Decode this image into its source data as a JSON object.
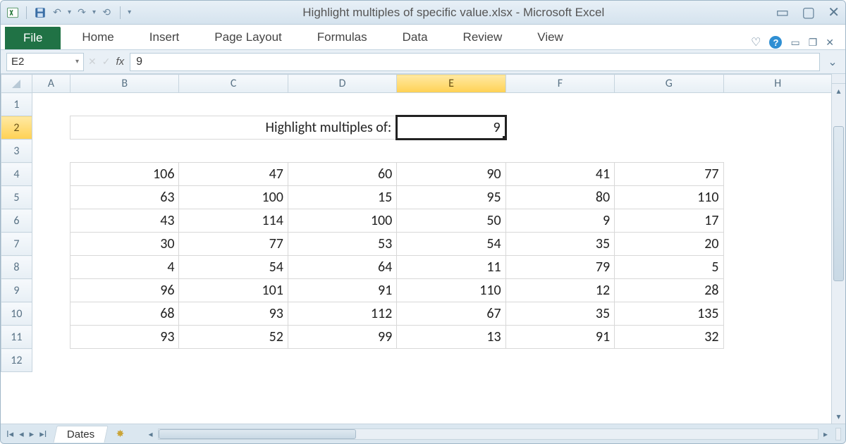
{
  "window": {
    "title": "Highlight multiples of specific value.xlsx  -  Microsoft Excel"
  },
  "ribbon": {
    "file": "File",
    "tabs": [
      "Home",
      "Insert",
      "Page Layout",
      "Formulas",
      "Data",
      "Review",
      "View"
    ]
  },
  "formula_bar": {
    "name_box": "E2",
    "fx_label": "fx",
    "value": "9"
  },
  "sheet": {
    "columns": [
      "A",
      "B",
      "C",
      "D",
      "E",
      "F",
      "G",
      "H"
    ],
    "row_headers": [
      "1",
      "2",
      "3",
      "4",
      "5",
      "6",
      "7",
      "8",
      "9",
      "10",
      "11",
      "12"
    ],
    "selected_cell": "E2",
    "label_text": "Highlight multiples of:",
    "input_value": "9",
    "data": [
      [
        106,
        47,
        60,
        90,
        41,
        77
      ],
      [
        63,
        100,
        15,
        95,
        80,
        110
      ],
      [
        43,
        114,
        100,
        50,
        9,
        17
      ],
      [
        30,
        77,
        53,
        54,
        35,
        20
      ],
      [
        4,
        54,
        64,
        11,
        79,
        5
      ],
      [
        96,
        101,
        91,
        110,
        12,
        28
      ],
      [
        68,
        93,
        112,
        67,
        35,
        135
      ],
      [
        93,
        52,
        99,
        13,
        91,
        32
      ]
    ],
    "highlight_divisor": 9
  },
  "tabs": {
    "active": "Dates"
  },
  "colors": {
    "highlight": "#b8e27a",
    "select_header": "#ffd154",
    "file_tab": "#207245"
  },
  "chart_data": {
    "type": "table",
    "title": "Highlight multiples of 9",
    "columns": [
      "B",
      "C",
      "D",
      "E",
      "F",
      "G"
    ],
    "rows_start": 4,
    "values": [
      [
        106,
        47,
        60,
        90,
        41,
        77
      ],
      [
        63,
        100,
        15,
        95,
        80,
        110
      ],
      [
        43,
        114,
        100,
        50,
        9,
        17
      ],
      [
        30,
        77,
        53,
        54,
        35,
        20
      ],
      [
        4,
        54,
        64,
        11,
        79,
        5
      ],
      [
        96,
        101,
        91,
        110,
        12,
        28
      ],
      [
        68,
        93,
        112,
        67,
        35,
        135
      ],
      [
        93,
        52,
        99,
        13,
        91,
        32
      ]
    ],
    "highlight_rule": "value mod 9 == 0"
  }
}
